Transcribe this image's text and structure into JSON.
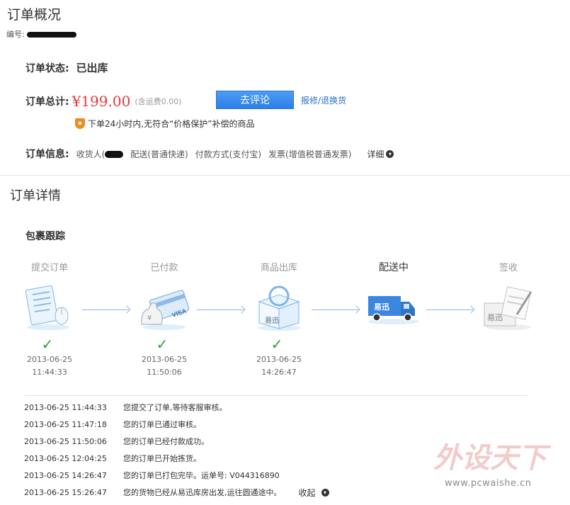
{
  "page_title": "订单概况",
  "order_no_label": "编号:",
  "status": {
    "label": "订单状态:",
    "value": "已出库"
  },
  "total": {
    "label": "订单总计:",
    "price": "¥199.00",
    "shipping": "(含运费0.00)",
    "review_button": "去评论",
    "repair_link": "报修/退换货"
  },
  "notice": {
    "icon": "shield-icon",
    "text": "下单24小时内,无符合“价格保护”补偿的商品"
  },
  "info": {
    "label": "订单信息:",
    "receiver_label": "收货人(",
    "delivery": "配送(普通快递)",
    "payment": "付款方式(支付宝)",
    "invoice": "发票(增值税普通发票)",
    "detail_toggle": "详细"
  },
  "details_title": "订单详情",
  "package_title": "包裹跟踪",
  "steps": [
    {
      "label": "提交订单",
      "icon": "order-form-icon",
      "done": true,
      "date": "2013-06-25",
      "time": "11:44:33"
    },
    {
      "label": "已付款",
      "icon": "payment-card-icon",
      "done": true,
      "date": "2013-06-25",
      "time": "11:50:06"
    },
    {
      "label": "商品出库",
      "icon": "package-box-icon",
      "done": true,
      "date": "2013-06-25",
      "time": "14:26:47"
    },
    {
      "label": "配送中",
      "icon": "delivery-truck-icon",
      "done": false,
      "date": "",
      "time": ""
    },
    {
      "label": "签收",
      "icon": "sign-receipt-icon",
      "done": false,
      "date": "",
      "time": ""
    }
  ],
  "brand_text": "易迅",
  "log": [
    {
      "time": "2013-06-25 11:44:33",
      "msg": "您提交了订单,等待客服审核。"
    },
    {
      "time": "2013-06-25 11:47:18",
      "msg": "您的订单已通过审核。"
    },
    {
      "time": "2013-06-25 11:50:06",
      "msg": "您的订单已经付款成功。"
    },
    {
      "time": "2013-06-25 12:04:25",
      "msg": "您的订单已开始拣货。"
    },
    {
      "time": "2013-06-25 14:26:47",
      "msg": "您的订单已打包完毕。运单号: V044316890"
    },
    {
      "time": "2013-06-25 15:26:47",
      "msg": "您的货物已经从易迅库房出发,运往圆通途中。"
    }
  ],
  "collapse_label": "收起",
  "watermark": {
    "logo_text": "外设天下",
    "url": "www.pcwaishe.cn"
  },
  "colors": {
    "price": "#e4393c",
    "link": "#2b6fc4",
    "check": "#2aa02a",
    "button": "#2b7fe8"
  }
}
